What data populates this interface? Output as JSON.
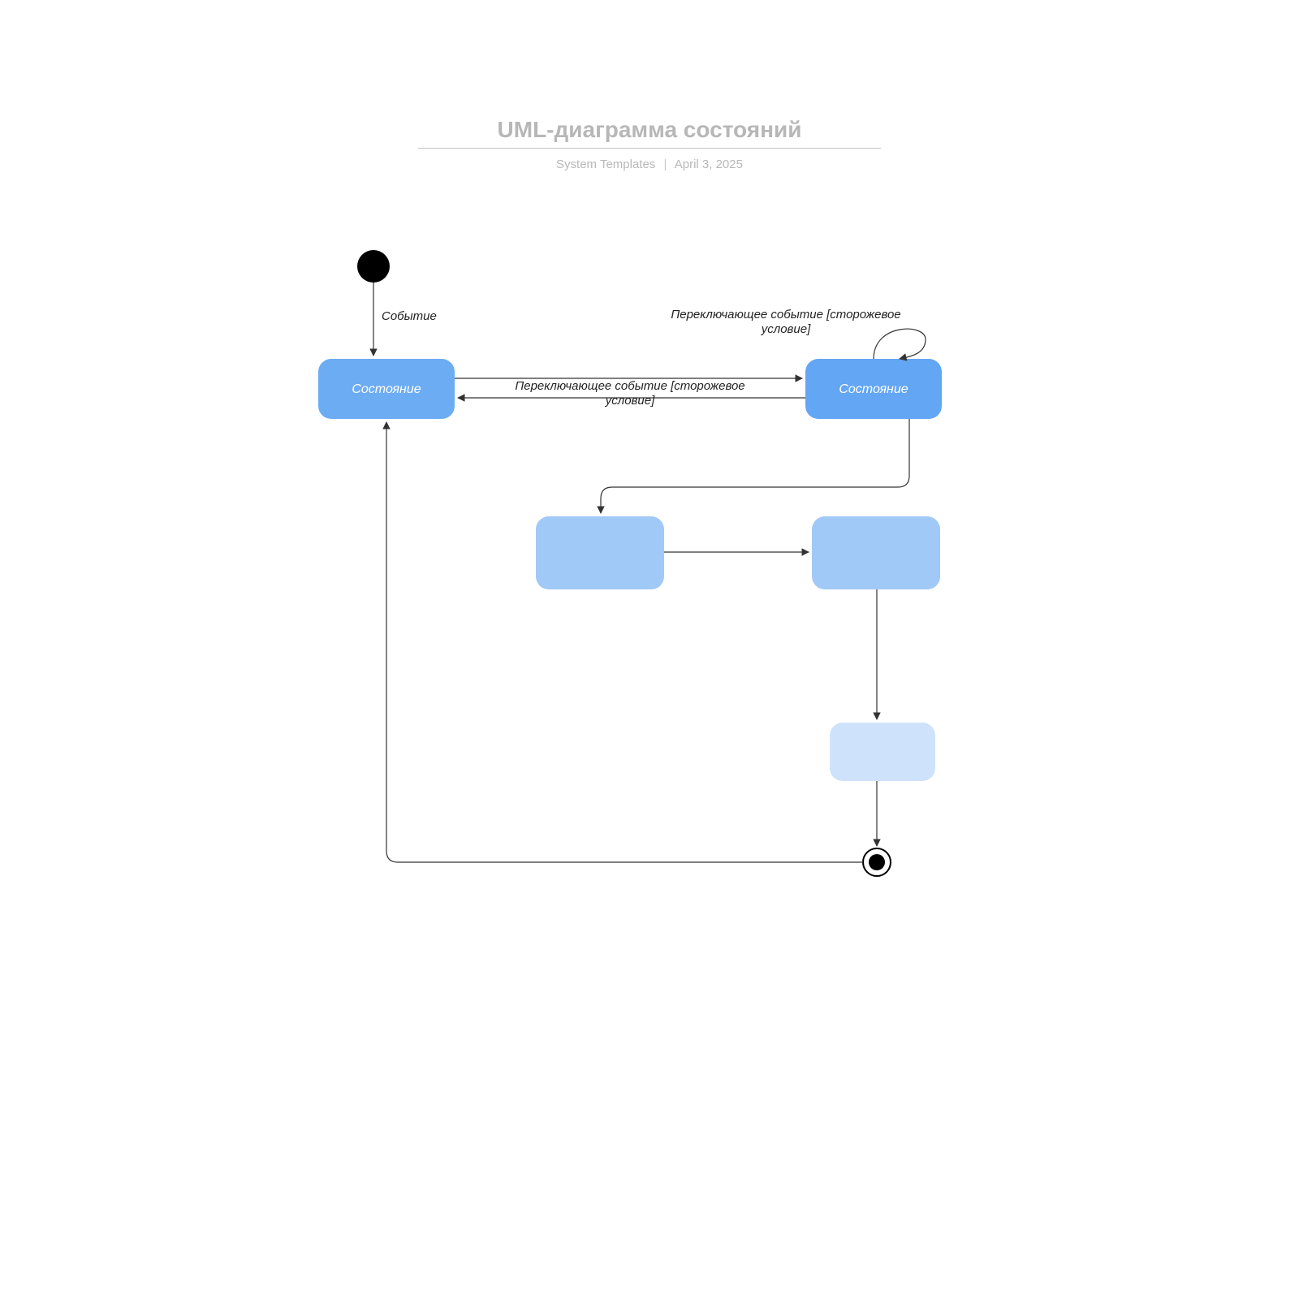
{
  "header": {
    "title": "UML-диаграмма состояний",
    "author": "System Templates",
    "date": "April 3, 2025"
  },
  "nodes": {
    "initial": {
      "type": "initial"
    },
    "state1": {
      "label": "Состояние",
      "fill": "#6cacf3",
      "text": "#ffffff"
    },
    "state2": {
      "label": "Состояние",
      "fill": "#63a6f4",
      "text": "#ffffff"
    },
    "state3": {
      "label": "",
      "fill": "#a1c9f7"
    },
    "state4": {
      "label": "",
      "fill": "#a1c9f7"
    },
    "state5": {
      "label": "",
      "fill": "#cfe2fb"
    },
    "final": {
      "type": "final"
    }
  },
  "edges": {
    "initial_to_state1": {
      "label": "Событие"
    },
    "state1_to_state2": {
      "label_line1": "Переключающее событие [сторожевое",
      "label_line2": "условие]"
    },
    "state2_to_state1": {
      "label": ""
    },
    "state2_self_loop": {
      "label_line1": "Переключающее событие [сторожевое",
      "label_line2": "условие]"
    },
    "state2_to_state3": {
      "label": ""
    },
    "state3_to_state4": {
      "label": ""
    },
    "state4_to_state5": {
      "label": ""
    },
    "state5_to_final": {
      "label": ""
    },
    "final_to_state1": {
      "label": ""
    }
  }
}
